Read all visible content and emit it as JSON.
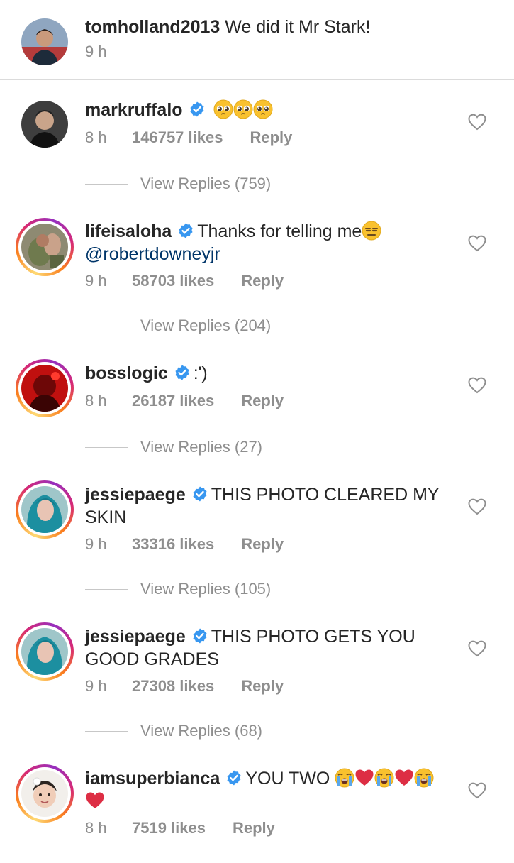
{
  "caption": {
    "username": "tomholland2013",
    "text": "We did it Mr Stark!",
    "time": "9 h"
  },
  "comments": [
    {
      "username": "markruffalo",
      "verified": true,
      "text": "",
      "emojis": [
        "pleading-face",
        "pleading-face",
        "pleading-face"
      ],
      "time": "8 h",
      "likes": "146757 likes",
      "reply_label": "Reply",
      "view_replies": "View Replies (759)"
    },
    {
      "username": "lifeisaloha",
      "verified": true,
      "text": "Thanks for telling me",
      "emojis": [
        "expressionless-face"
      ],
      "mention": "@robertdowneyjr",
      "time": "9 h",
      "likes": "58703 likes",
      "reply_label": "Reply",
      "view_replies": "View Replies (204)"
    },
    {
      "username": "bosslogic",
      "verified": true,
      "text": ":')",
      "time": "8 h",
      "likes": "26187 likes",
      "reply_label": "Reply",
      "view_replies": "View Replies (27)"
    },
    {
      "username": "jessiepaege",
      "verified": true,
      "text": "THIS PHOTO CLEARED MY SKIN",
      "time": "9 h",
      "likes": "33316 likes",
      "reply_label": "Reply",
      "view_replies": "View Replies (105)"
    },
    {
      "username": "jessiepaege",
      "verified": true,
      "text": "THIS PHOTO GETS YOU GOOD GRADES",
      "time": "9 h",
      "likes": "27308 likes",
      "reply_label": "Reply",
      "view_replies": "View Replies (68)"
    },
    {
      "username": "iamsuperbianca",
      "verified": true,
      "text": "YOU TWO",
      "emojis": [
        "loudly-crying-face",
        "red-heart",
        "loudly-crying-face",
        "red-heart",
        "loudly-crying-face",
        "red-heart"
      ],
      "time": "8 h",
      "likes": "7519 likes",
      "reply_label": "Reply"
    }
  ],
  "colors": {
    "text": "#262626",
    "meta": "#8e8e8e",
    "verified": "#3897f0",
    "mention": "#003569",
    "divider": "#dbdbdb"
  },
  "icons": {
    "verified": "verified-badge-icon",
    "like": "heart-outline-icon"
  }
}
